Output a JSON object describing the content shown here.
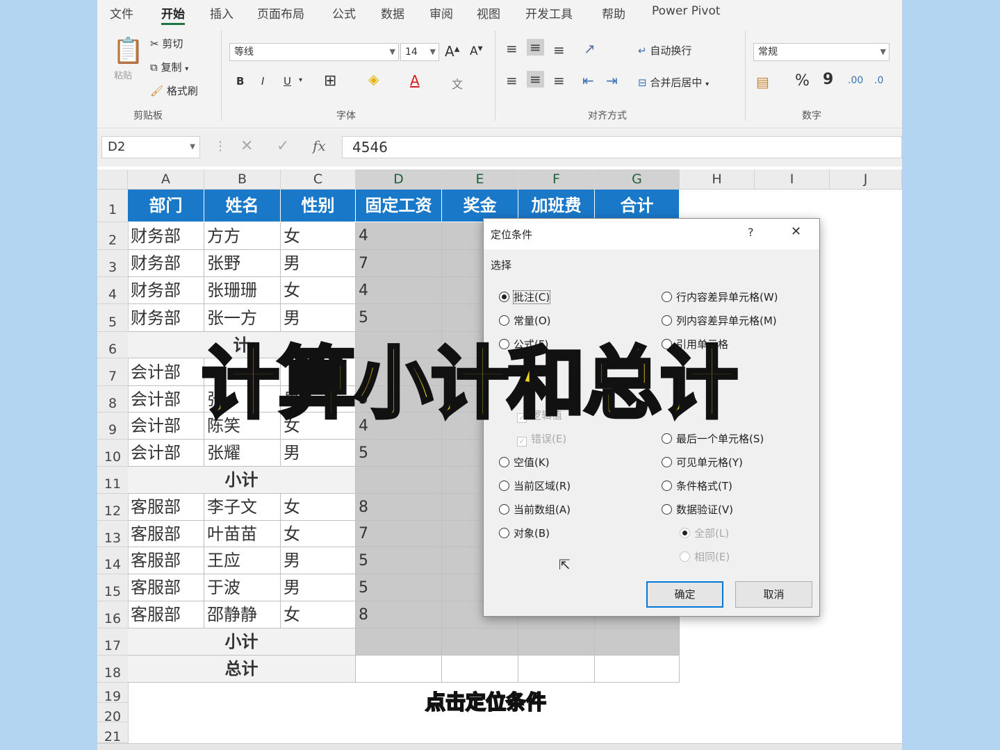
{
  "tabs": [
    "文件",
    "开始",
    "插入",
    "页面布局",
    "公式",
    "数据",
    "审阅",
    "视图",
    "开发工具",
    "帮助",
    "Power Pivot"
  ],
  "ribbon": {
    "clipboard": {
      "paste": "粘贴",
      "cut": "剪切",
      "copy": "复制",
      "format_painter": "格式刷",
      "label": "剪贴板"
    },
    "font": {
      "name": "等线",
      "size": "14",
      "grow": "A",
      "shrink": "A",
      "bold": "B",
      "italic": "I",
      "underline": "U",
      "font_color": "A",
      "phonetic": "文",
      "label": "字体"
    },
    "alignment": {
      "wrap": "自动换行",
      "merge": "合并后居中",
      "label": "对齐方式"
    },
    "number": {
      "format": "常规",
      "percent": "%",
      "comma": "9",
      "inc_decimal": ".00",
      "dec_decimal": ".0",
      "label": "数字"
    }
  },
  "formula_bar": {
    "name_box": "D2",
    "fx": "fx",
    "value": "4546"
  },
  "columns": [
    "A",
    "B",
    "C",
    "D",
    "E",
    "F",
    "G",
    "H",
    "I",
    "J"
  ],
  "rows": [
    "1",
    "2",
    "3",
    "4",
    "5",
    "6",
    "7",
    "8",
    "9",
    "10",
    "11",
    "12",
    "13",
    "14",
    "15",
    "16",
    "17",
    "18",
    "19",
    "20",
    "21"
  ],
  "table": {
    "headers": [
      "部门",
      "姓名",
      "性别",
      "固定工资",
      "奖金",
      "加班费",
      "合计"
    ],
    "data": [
      [
        "财务部",
        "方方",
        "女",
        "4"
      ],
      [
        "财务部",
        "张野",
        "男",
        "7"
      ],
      [
        "财务部",
        "张珊珊",
        "女",
        "4"
      ],
      [
        "财务部",
        "张一方",
        "男",
        "5"
      ],
      [
        "会计部",
        "",
        "",
        ""
      ],
      [
        "会计部",
        "张",
        "男",
        "5"
      ],
      [
        "会计部",
        "陈笑",
        "女",
        "4"
      ],
      [
        "会计部",
        "张耀",
        "男",
        "5"
      ],
      [
        "客服部",
        "李子文",
        "女",
        "8"
      ],
      [
        "客服部",
        "叶苗苗",
        "女",
        "7"
      ],
      [
        "客服部",
        "王应",
        "男",
        "5"
      ],
      [
        "客服部",
        "于波",
        "男",
        "5"
      ],
      [
        "客服部",
        "邵静静",
        "女",
        "8"
      ]
    ],
    "row6_partial": "计",
    "subtotal": "小计",
    "total": "总计"
  },
  "dialog": {
    "title": "定位条件",
    "help": "?",
    "close": "✕",
    "section": "选择",
    "left_options": [
      "批注(C)",
      "常量(O)",
      "公式(F)",
      "",
      "",
      "逻辑值",
      "错误(E)",
      "空值(K)",
      "当前区域(R)",
      "当前数组(A)",
      "对象(B)"
    ],
    "right_options": [
      "行内容差异单元格(W)",
      "列内容差异单元格(M)",
      "引用单元格",
      "",
      "",
      "",
      "最后一个单元格(S)",
      "可见单元格(Y)",
      "条件格式(T)",
      "数据验证(V)",
      "全部(L)",
      "相同(E)"
    ],
    "ok": "确定",
    "cancel": "取消"
  },
  "overlay_title": "计算小计和总计",
  "caption": "点击定位条件",
  "colors": {
    "header_blue": "#1a78c9",
    "excel_green": "#217346",
    "title_yellow": "#f8d31b",
    "background": "#b3d5f1"
  }
}
